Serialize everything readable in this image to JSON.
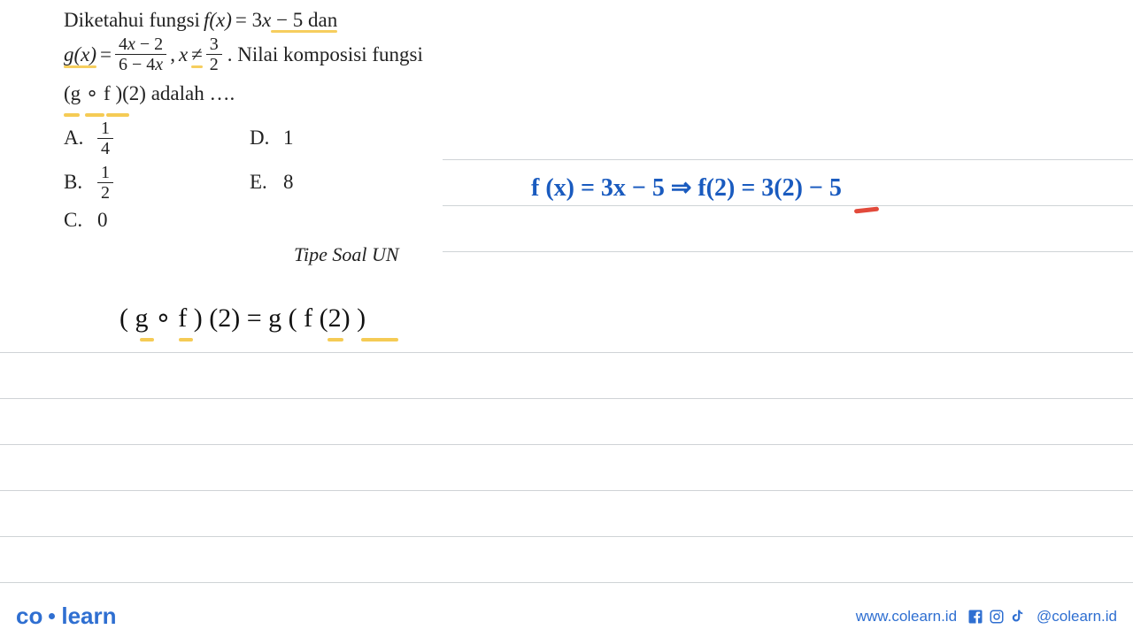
{
  "problem": {
    "line1_pre": "Diketahui fungsi ",
    "fx": "f(x)",
    "eq1": " = 3",
    "x1": "x",
    "minus5": " − 5 dan",
    "gx": "g(x)",
    "eq2": " = ",
    "frac1_num_a": "4",
    "frac1_num_x": "x",
    "frac1_num_b": " − 2",
    "frac1_den_a": "6 − 4",
    "frac1_den_x": "x",
    "comma": ", ",
    "x2": "x",
    "neq": " ≠ ",
    "frac2_num": "3",
    "frac2_den": "2",
    "period": ". Nilai komposisi fungsi",
    "comp": "(g ∘ f )(2) adalah …."
  },
  "options": {
    "A": {
      "label": "A.",
      "num": "1",
      "den": "4"
    },
    "B": {
      "label": "B.",
      "num": "1",
      "den": "2"
    },
    "C": {
      "label": "C.",
      "value": "0"
    },
    "D": {
      "label": "D.",
      "value": "1"
    },
    "E": {
      "label": "E.",
      "value": "8"
    }
  },
  "tipe": "Tipe Soal UN",
  "hand_blue": "f (x) = 3x − 5  ⇒  f(2) = 3(2) − 5",
  "hand_black": "( g ∘ f ) (2)   =   g ( f (2) )",
  "footer": {
    "logo_a": "co",
    "logo_b": "learn",
    "url": "www.colearn.id",
    "handle": "@colearn.id"
  }
}
